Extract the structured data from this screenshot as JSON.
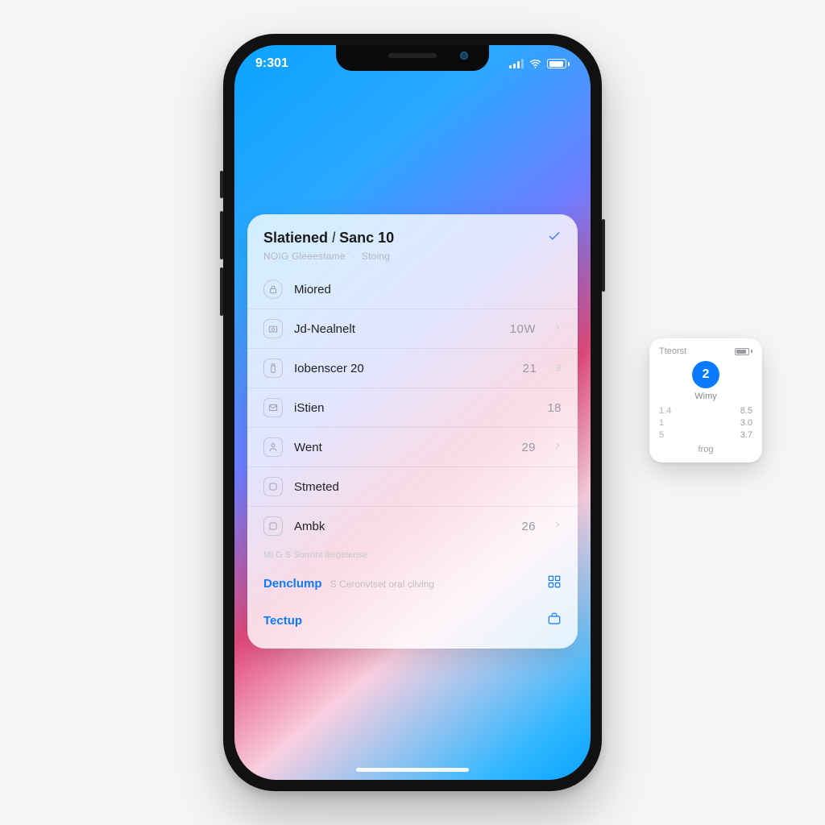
{
  "status": {
    "time": "9:301"
  },
  "card": {
    "title_left": "Slatiened",
    "title_sep": "l",
    "title_right": "Sanc 10",
    "subtitle_a": "NOIG Gleeestame",
    "subtitle_b": "Stoing"
  },
  "rows": [
    {
      "icon": "lock-icon",
      "label": "Miored",
      "value": "",
      "extra": "",
      "chevron": false,
      "round": true
    },
    {
      "icon": "camera-icon",
      "label": "Jd-Nealnelt",
      "value": "10W",
      "extra": "",
      "chevron": true,
      "round": false
    },
    {
      "icon": "bottle-icon",
      "label": "Iobenscer 20",
      "value": "21",
      "extra": "8",
      "chevron": false,
      "round": false
    },
    {
      "icon": "envelope-icon",
      "label": "iStien",
      "value": "18",
      "extra": "",
      "chevron": false,
      "round": false
    },
    {
      "icon": "person-icon",
      "label": "Went",
      "value": "29",
      "extra": "",
      "chevron": true,
      "round": false
    },
    {
      "icon": "square-icon",
      "label": "Stmeted",
      "value": "",
      "extra": "",
      "chevron": false,
      "round": false
    },
    {
      "icon": "square-icon",
      "label": "Ambk",
      "value": "26",
      "extra": "",
      "chevron": true,
      "round": false
    }
  ],
  "footer": {
    "note": "MI G S Sorrnnt iliegetense",
    "action1_label": "Denclump",
    "action1_sub": "S Ceronvtset oral cliving",
    "action2_label": "Tectup"
  },
  "widget": {
    "title": "Tteorst",
    "badge": "2",
    "caption": "Wimy",
    "grid": [
      {
        "a": "1.4",
        "b": "8.5"
      },
      {
        "a": "1",
        "b": "3.0"
      },
      {
        "a": "5",
        "b": "3.7"
      }
    ],
    "bottom": "frog"
  }
}
